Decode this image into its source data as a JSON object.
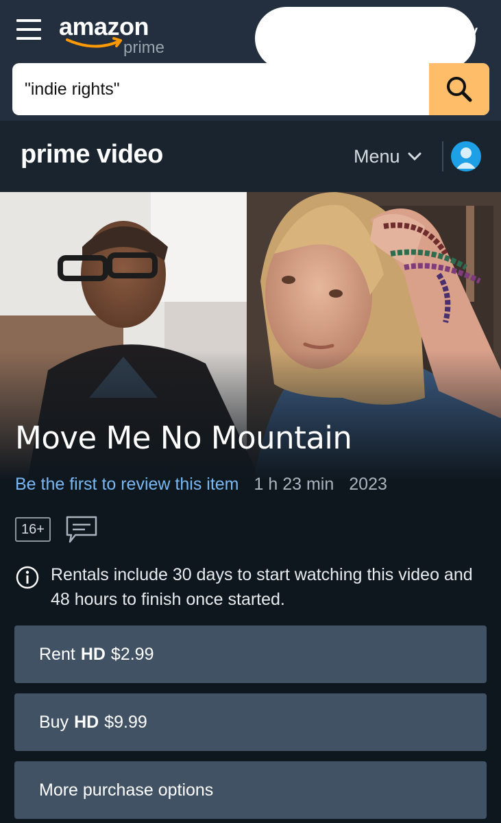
{
  "header": {
    "logo_word": "amazon",
    "logo_sub": "prime",
    "search": {
      "value": "\"indie rights\""
    }
  },
  "pv_nav": {
    "logo": "prime video",
    "menu_label": "Menu"
  },
  "title": {
    "text": "Move Me No Mountain",
    "review_link": "Be the first to review this item",
    "runtime": "1 h 23 min",
    "year": "2023",
    "rating": "16+"
  },
  "rental_info": {
    "text": "Rentals include 30 days to start watching this video and 48 hours to finish once started."
  },
  "purchase": {
    "rent": {
      "label": "Rent",
      "quality": "HD",
      "price": "$2.99"
    },
    "buy": {
      "label": "Buy",
      "quality": "HD",
      "price": "$9.99"
    },
    "more": {
      "label": "More purchase options"
    }
  },
  "colors": {
    "header_bg": "#232f3e",
    "nav_bg": "#1a242f",
    "page_bg": "#0f171e",
    "search_button": "#febd69",
    "link": "#79b8f3",
    "button_bg": "#425265",
    "avatar": "#1ea0e6"
  },
  "icons": {
    "menu": "hamburger-icon",
    "search": "search-icon",
    "dropdown": "chevron-down-icon",
    "profile": "profile-icon",
    "subtitles": "subtitles-icon",
    "info": "info-icon"
  }
}
